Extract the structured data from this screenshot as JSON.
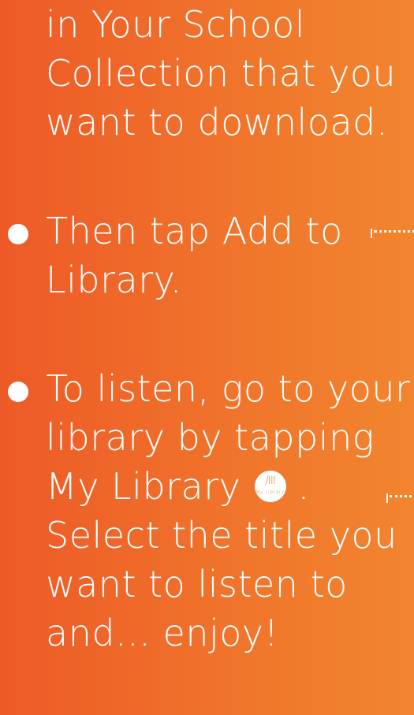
{
  "section1": {
    "lines": [
      "in Your School",
      "Collection that you",
      "want to download."
    ]
  },
  "section2": {
    "lines": [
      "Then tap Add to",
      "Library."
    ]
  },
  "section3": {
    "lines": [
      "To listen, go to your",
      "library by tapping",
      "My Library",
      ".",
      "Select the title you",
      "want to listen to",
      "and... enjoy!"
    ]
  },
  "my_library_icon": {
    "icon": "my-library-icon",
    "label": "My Library",
    "bars": "/III"
  }
}
